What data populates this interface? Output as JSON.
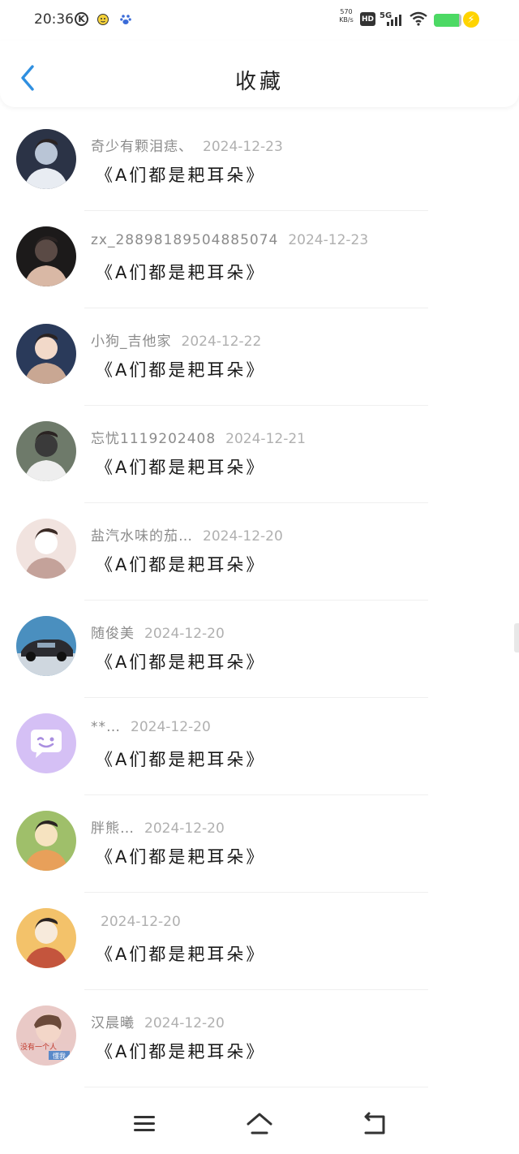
{
  "status_bar": {
    "time": "20:36",
    "speed_top": "570",
    "speed_unit": "KB/s",
    "hd": "HD",
    "network": "5G",
    "battery_level": 0.9
  },
  "header": {
    "title": "收藏"
  },
  "items": [
    {
      "username": "奇少有颗泪痣、",
      "date": "2024-12-23",
      "title": "《A们都是耙耳朵》",
      "avatar_palette": [
        "#2b3346",
        "#e8ecf2",
        "#b9c5d6"
      ]
    },
    {
      "username": "zx_28898189504885074",
      "date": "2024-12-23",
      "title": "《A们都是耙耳朵》",
      "avatar_palette": [
        "#1c1a1a",
        "#d9b8a5",
        "#5a4a45"
      ]
    },
    {
      "username": "小狗_吉他家",
      "date": "2024-12-22",
      "title": "《A们都是耙耳朵》",
      "avatar_palette": [
        "#2a3a5a",
        "#c9a793",
        "#f2d9c9"
      ]
    },
    {
      "username": "忘忧1119202408",
      "date": "2024-12-21",
      "title": "《A们都是耙耳朵》",
      "avatar_palette": [
        "#6e7a6a",
        "#eeeeee",
        "#3a3a3a"
      ]
    },
    {
      "username": "盐汽水味的茄…",
      "date": "2024-12-20",
      "title": "《A们都是耙耳朵》",
      "avatar_palette": [
        "#f1e3df",
        "#c4a29a",
        "#ffffff"
      ]
    },
    {
      "username": "随俊美",
      "date": "2024-12-20",
      "title": "《A们都是耙耳朵》",
      "avatar_palette": [
        "#4a8fbf",
        "#2b2b30",
        "#cfd7df"
      ]
    },
    {
      "username": "**…",
      "date": "2024-12-20",
      "title": "《A们都是耙耳朵》",
      "avatar_palette": [
        "#d5c0f5",
        "#ffffff",
        "#a98ee0"
      ]
    },
    {
      "username": "胖熊…",
      "date": "2024-12-20",
      "title": "《A们都是耙耳朵》",
      "avatar_palette": [
        "#9fbf6a",
        "#e8a05a",
        "#f6e3c0"
      ]
    },
    {
      "username": "",
      "date": "2024-12-20",
      "title": "《A们都是耙耳朵》",
      "avatar_palette": [
        "#f3c26a",
        "#c4553d",
        "#f7eadb"
      ]
    },
    {
      "username": "汉晨曦",
      "date": "2024-12-20",
      "title": "《A们都是耙耳朵》",
      "avatar_palette": [
        "#e9c9c6",
        "#5a8ac9",
        "#ffffff"
      ]
    }
  ],
  "avatar_texts": {
    "last": [
      "没有一个人",
      "懂我"
    ]
  },
  "colors": {
    "accent": "#2f8fe0",
    "title_text": "#1a1a1a",
    "meta_text": "#8b8b8b"
  },
  "icons": {
    "back": "chevron-left-icon",
    "menu": "menu-icon",
    "home": "home-icon",
    "return": "return-icon"
  }
}
